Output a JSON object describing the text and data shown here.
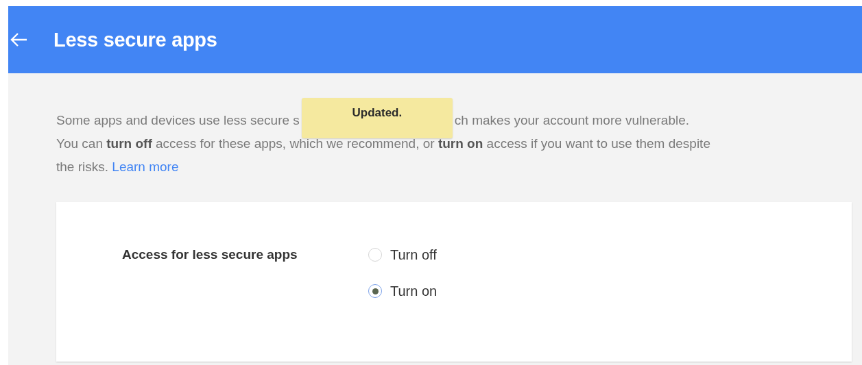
{
  "header": {
    "title": "Less secure apps"
  },
  "toast": {
    "text": "Updated."
  },
  "intro": {
    "visible_start": "Some apps and devices use less secure s",
    "visible_end": "ch makes your account more vulnerable.",
    "text": "You can **turn off** access for these apps, which we recommend, or **turn on** access if you want to use them despite the risks.",
    "link": "Learn more"
  },
  "setting": {
    "label": "Access for less secure apps",
    "options": [
      {
        "label": "Turn off",
        "selected": false
      },
      {
        "label": "Turn on",
        "selected": true
      }
    ]
  }
}
